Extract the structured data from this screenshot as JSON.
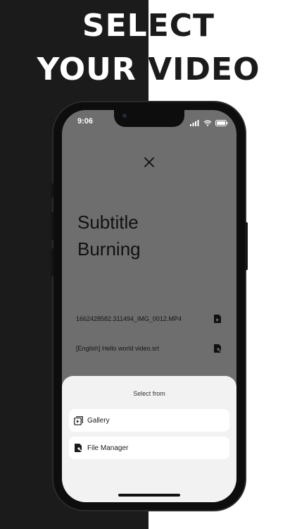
{
  "headline": {
    "line1": "SELECT",
    "line2": "YOUR VIDEO"
  },
  "status_bar": {
    "time": "9:06",
    "icons": [
      "signal-icon",
      "wifi-icon",
      "battery-icon"
    ]
  },
  "screen": {
    "close_icon": "close-icon",
    "title_line1": "Subtitle",
    "title_line2": "Burning",
    "files": [
      {
        "name": "1662428582.311494_IMG_0012.MP4",
        "icon": "video-file-icon"
      },
      {
        "name": "[English] Hello world video.srt",
        "icon": "subtitle-file-icon"
      }
    ]
  },
  "sheet": {
    "title": "Select from",
    "options": [
      {
        "label": "Gallery",
        "icon": "gallery-icon"
      },
      {
        "label": "File Manager",
        "icon": "file-manager-icon"
      }
    ]
  },
  "colors": {
    "left_background": "#1b1b1b",
    "right_background": "#ffffff",
    "screen_background": "#6e6e6e",
    "sheet_background": "#f2f2f2"
  }
}
